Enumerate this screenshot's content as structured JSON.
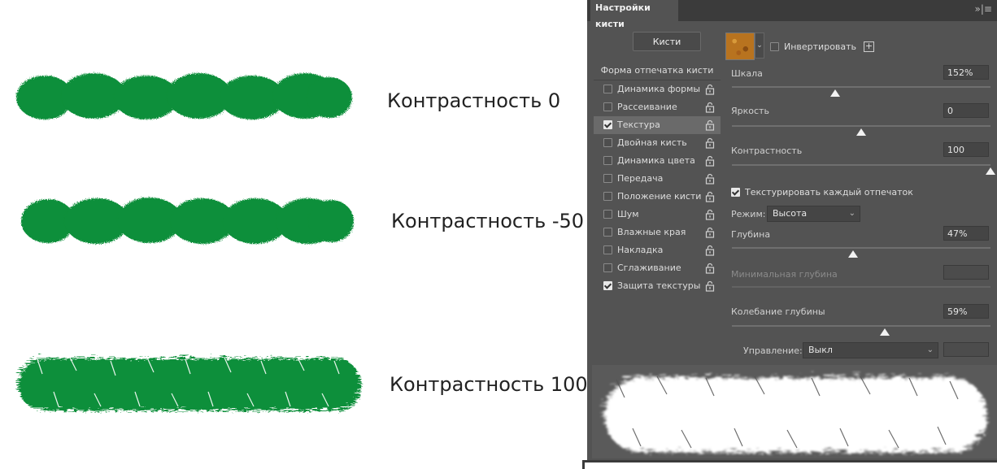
{
  "captions": [
    "Контрастность 0",
    "Контрастность -50",
    "Контрастность 100"
  ],
  "colors": {
    "stroke_green": "#0b8f3a",
    "panel_bg": "#535353",
    "tabbar_bg": "#3b3b3b"
  },
  "panel": {
    "tab_title": "Настройки кисти",
    "tabbar_icons": "»|≡",
    "brushes_button": "Кисти",
    "list_header": "Форма отпечатка кисти",
    "list_items": [
      {
        "label": "Динамика формы",
        "checked": false
      },
      {
        "label": "Рассеивание",
        "checked": false
      },
      {
        "label": "Текстура",
        "checked": true,
        "active": true
      },
      {
        "label": "Двойная кисть",
        "checked": false
      },
      {
        "label": "Динамика цвета",
        "checked": false
      },
      {
        "label": "Передача",
        "checked": false
      },
      {
        "label": "Положение кисти",
        "checked": false
      },
      {
        "label": "Шум",
        "checked": false
      },
      {
        "label": "Влажные края",
        "checked": false
      },
      {
        "label": "Накладка",
        "checked": false
      },
      {
        "label": "Сглаживание",
        "checked": false
      },
      {
        "label": "Защита текстуры",
        "checked": true
      }
    ],
    "invert_label": "Инвертировать",
    "invert_checked": false,
    "scale": {
      "label": "Шкала",
      "value": "152%",
      "level": 0.4
    },
    "brightness": {
      "label": "Яркость",
      "value": "0",
      "level": 0.5
    },
    "contrast": {
      "label": "Контрастность",
      "value": "100",
      "level": 1.0
    },
    "texture_each_tip": {
      "label": "Текстурировать каждый отпечаток",
      "checked": true
    },
    "mode": {
      "label": "Режим:",
      "value": "Высота"
    },
    "depth": {
      "label": "Глубина",
      "value": "47%",
      "level": 0.47
    },
    "min_depth": {
      "label": "Минимальная глубина",
      "value": ""
    },
    "depth_jitter": {
      "label": "Колебание глубины",
      "value": "59%",
      "level": 0.59
    },
    "control": {
      "label": "Управление:",
      "value": "Выкл"
    }
  }
}
